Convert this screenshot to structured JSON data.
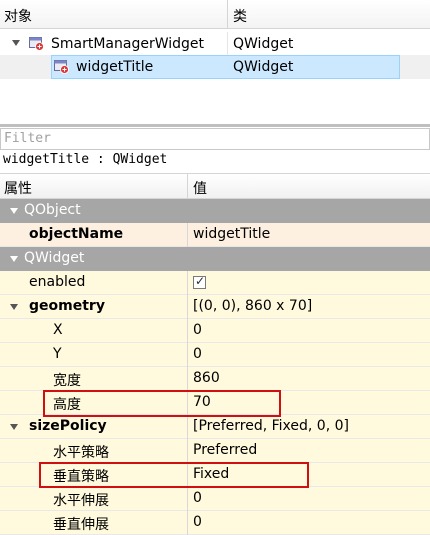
{
  "object_inspector": {
    "headers": {
      "object": "对象",
      "class": "类"
    },
    "rows": [
      {
        "object": "SmartManagerWidget",
        "class": "QWidget",
        "icon": "widget-icon"
      },
      {
        "object": "widgetTitle",
        "class": "QWidget",
        "icon": "widget-icon",
        "selected": true
      }
    ]
  },
  "property_editor": {
    "filter_placeholder": "Filter",
    "class_line": "widgetTitle : QWidget",
    "headers": {
      "property": "属性",
      "value": "值"
    },
    "groups": [
      {
        "name": "QObject",
        "props": [
          {
            "name": "objectName",
            "value": "widgetTitle"
          }
        ]
      },
      {
        "name": "QWidget",
        "props": [
          {
            "name": "enabled",
            "value": "",
            "checked": true
          },
          {
            "name": "geometry",
            "value": "[(0, 0), 860 x 70]",
            "children": [
              {
                "name": "X",
                "value": "0"
              },
              {
                "name": "Y",
                "value": "0"
              },
              {
                "name": "宽度",
                "value": "860"
              },
              {
                "name": "高度",
                "value": "70",
                "highlighted": true
              }
            ]
          },
          {
            "name": "sizePolicy",
            "value": "[Preferred, Fixed, 0, 0]",
            "children": [
              {
                "name": "水平策略",
                "value": "Preferred"
              },
              {
                "name": "垂直策略",
                "value": "Fixed",
                "highlighted": true
              },
              {
                "name": "水平伸展",
                "value": "0"
              },
              {
                "name": "垂直伸展",
                "value": "0"
              }
            ]
          }
        ]
      }
    ]
  },
  "colors": {
    "group_header": "#a6a6a6",
    "qobject_row": "#fdf0e0",
    "qwidget_row": "#fff9dd",
    "highlight_box": "#d01010",
    "selection": "#cce8ff"
  }
}
